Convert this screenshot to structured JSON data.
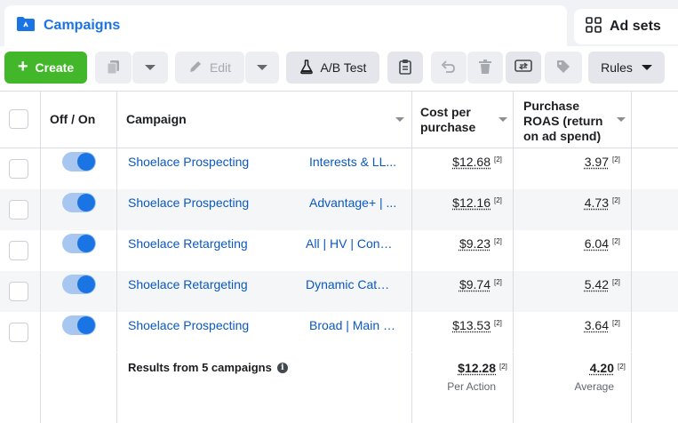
{
  "tabs": {
    "campaigns_label": "Campaigns",
    "adsets_label": "Ad sets"
  },
  "toolbar": {
    "create_label": "Create",
    "edit_label": "Edit",
    "ab_test_label": "A/B Test",
    "rules_label": "Rules",
    "icons": [
      "duplicate-icon",
      "chevron-down-icon",
      "pencil-icon",
      "chevron-down-icon",
      "flask-icon",
      "clipboard-icon",
      "undo-icon",
      "trash-icon",
      "compare-icon",
      "tag-icon"
    ]
  },
  "columns": {
    "off_on": "Off / On",
    "campaign": "Campaign",
    "cost_per_purchase": "Cost per purchase",
    "purchase_roas": "Purchase ROAS (return on ad spend)"
  },
  "rows": [
    {
      "campaign": "Shoelace Prospecting",
      "adset": "Interests & LL...",
      "cost": "$12.68",
      "cost_fn": "[2]",
      "roas": "3.97",
      "roas_fn": "[2]",
      "on": true
    },
    {
      "campaign": "Shoelace Prospecting",
      "adset": "Advantage+ | ...",
      "cost": "$12.16",
      "cost_fn": "[2]",
      "roas": "4.73",
      "roas_fn": "[2]",
      "on": true
    },
    {
      "campaign": "Shoelace Retargeting",
      "adset": "All | HV | Conv...",
      "cost": "$9.23",
      "cost_fn": "[2]",
      "roas": "6.04",
      "roas_fn": "[2]",
      "on": true
    },
    {
      "campaign": "Shoelace Retargeting",
      "adset": "Dynamic Catal...",
      "cost": "$9.74",
      "cost_fn": "[2]",
      "roas": "5.42",
      "roas_fn": "[2]",
      "on": true
    },
    {
      "campaign": "Shoelace Prospecting",
      "adset": "Broad | Main | ...",
      "cost": "$13.53",
      "cost_fn": "[2]",
      "roas": "3.64",
      "roas_fn": "[2]",
      "on": true
    }
  ],
  "summary": {
    "title": "Results from 5 campaigns",
    "cost": "$12.28",
    "cost_fn": "[2]",
    "cost_sub": "Per Action",
    "roas": "4.20",
    "roas_fn": "[2]",
    "roas_sub": "Average"
  },
  "colors": {
    "accent": "#1b74e4",
    "create_green": "#42b72a",
    "link": "#0a58c2"
  }
}
